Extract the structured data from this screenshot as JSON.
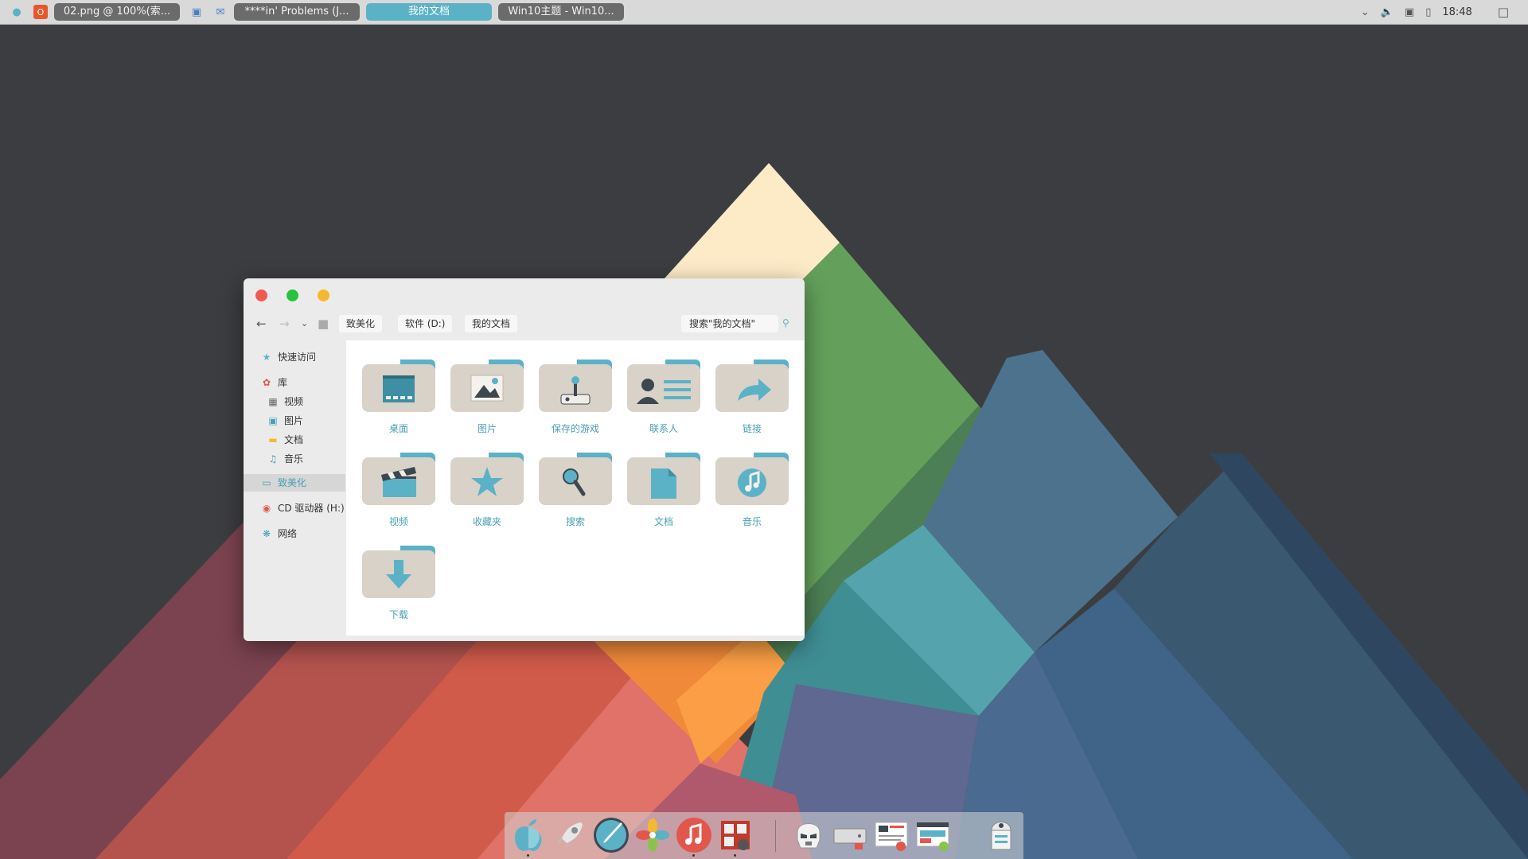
{
  "taskbar": {
    "tasks": [
      {
        "label": "02.png @ 100%(索..."
      },
      {
        "label": "****in' Problems (J..."
      },
      {
        "label": "我的文档"
      },
      {
        "label": "Win10主题 - Win10..."
      }
    ],
    "clock": "18:48"
  },
  "explorer": {
    "breadcrumbs": [
      "致美化",
      "软件 (D:)",
      "我的文档"
    ],
    "search_placeholder": "搜索\"我的文档\"",
    "sidebar": {
      "quick_access": "快速访问",
      "library": "库",
      "video": "视频",
      "pictures": "图片",
      "documents": "文档",
      "music": "音乐",
      "zhimeihua": "致美化",
      "cd_drive": "CD 驱动器 (H:)",
      "network": "网络"
    },
    "folders": [
      {
        "label": "桌面",
        "icon": "desktop-icon"
      },
      {
        "label": "图片",
        "icon": "picture-icon"
      },
      {
        "label": "保存的游戏",
        "icon": "joystick-icon"
      },
      {
        "label": "联系人",
        "icon": "contact-icon"
      },
      {
        "label": "链接",
        "icon": "link-arrow-icon"
      },
      {
        "label": "视频",
        "icon": "clapperboard-icon"
      },
      {
        "label": "收藏夹",
        "icon": "star-icon"
      },
      {
        "label": "搜索",
        "icon": "magnifier-icon"
      },
      {
        "label": "文档",
        "icon": "document-icon"
      },
      {
        "label": "音乐",
        "icon": "music-note-icon"
      },
      {
        "label": "下载",
        "icon": "download-arrow-icon"
      }
    ]
  },
  "colors": {
    "accent": "#5bb2c7",
    "folder_body": "#d9d2c8",
    "folder_tab": "#5bb2c7",
    "desktop_bg": "#3c3d40"
  }
}
